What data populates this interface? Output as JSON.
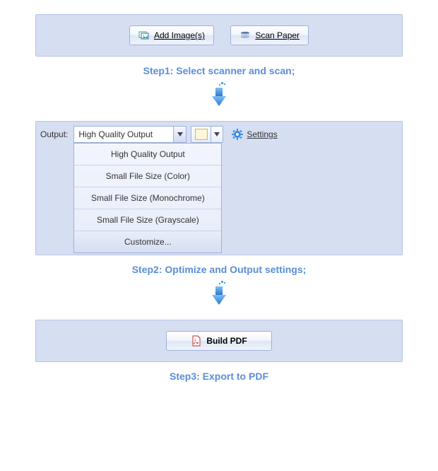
{
  "step1": {
    "add_images_label": "Add Image(s)",
    "scan_paper_label": "Scan Paper",
    "caption": "Step1: Select scanner and scan;"
  },
  "step2": {
    "output_label": "Output:",
    "selected": "High Quality Output",
    "options": {
      "opt0": "High Quality Output",
      "opt1": "Small File Size (Color)",
      "opt2": "Small File Size (Monochrome)",
      "opt3": "Small File Size (Grayscale)",
      "opt4": "Customize..."
    },
    "settings_label": "Settings",
    "caption": "Step2: Optimize and Output settings;",
    "swatch_color": "#fdf6d8"
  },
  "step3": {
    "build_pdf_label": "Build PDF",
    "caption": "Step3: Export to PDF"
  }
}
